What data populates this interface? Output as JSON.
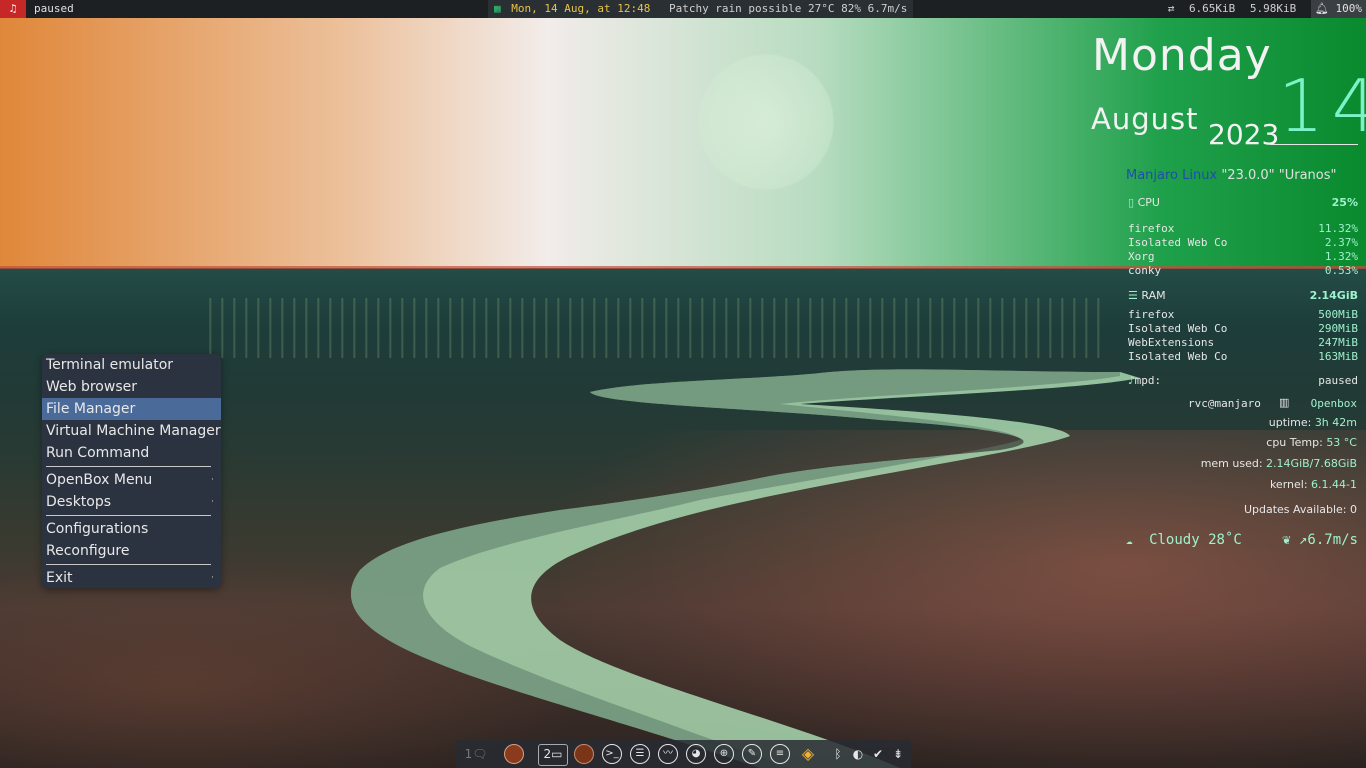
{
  "topbar": {
    "music_icon": "♫",
    "player_status": "paused",
    "calendar_icon": "calendar-icon",
    "datetime": "Mon, 14 Aug, at 12:48",
    "weather": "Patchy rain possible 27°C 82% 6.7m/s",
    "net_icon": "⇄",
    "net_down": "6.65KiB",
    "net_up": "5.98KiB",
    "bell_icon": "bell-icon",
    "volume": "100%"
  },
  "conky": {
    "day_name": "Monday",
    "month": "August",
    "year": "2023",
    "day_number": "14",
    "distro_name": "Manjaro Linux",
    "distro_version": "\"23.0.0\" \"Uranos\"",
    "cpu": {
      "label": "CPU",
      "total": "25%",
      "processes": [
        {
          "name": "firefox",
          "value": "11.32%"
        },
        {
          "name": "Isolated Web Co",
          "value": "2.37%"
        },
        {
          "name": "Xorg",
          "value": "1.32%"
        },
        {
          "name": "conky",
          "value": "0.53%"
        }
      ]
    },
    "ram": {
      "label": "RAM",
      "total": "2.14GiB",
      "processes": [
        {
          "name": "firefox",
          "value": "500MiB"
        },
        {
          "name": "Isolated Web Co",
          "value": "290MiB"
        },
        {
          "name": "WebExtensions",
          "value": "247MiB"
        },
        {
          "name": "Isolated Web Co",
          "value": "163MiB"
        }
      ]
    },
    "mpd_label": "mpd:",
    "mpd_status": "paused",
    "user": "rvc@manjaro",
    "wm": "Openbox",
    "uptime_label": "uptime:",
    "uptime": "3h 42m",
    "cpu_temp_label": "cpu Temp:",
    "cpu_temp": "53 °C",
    "mem_used_label": "mem used:",
    "mem_used": "2.14GiB/7.68GiB",
    "kernel_label": "kernel:",
    "kernel": "6.1.44-1",
    "updates_label": "Updates Available:",
    "updates": "0",
    "weather_condition": "Cloudy 28˚C",
    "wind": "↗6.7m/s"
  },
  "menu": {
    "items": [
      {
        "label": "Terminal emulator"
      },
      {
        "label": "Web browser"
      },
      {
        "label": "File Manager"
      },
      {
        "label": "Virtual Machine Manager"
      },
      {
        "label": "Run Command"
      },
      {
        "label": "OpenBox Menu"
      },
      {
        "label": "Desktops"
      },
      {
        "label": "Configurations"
      },
      {
        "label": "Reconfigure"
      },
      {
        "label": "Exit"
      }
    ],
    "submenu_arrow": "·"
  },
  "dock": {
    "workspace_1": "1",
    "workspace_2": "2"
  },
  "colors": {
    "accent": "#9ff1cc",
    "menu_bg": "#2b3340",
    "menu_active": "#4a6a9a",
    "topbar_bg": "#1d2023"
  }
}
